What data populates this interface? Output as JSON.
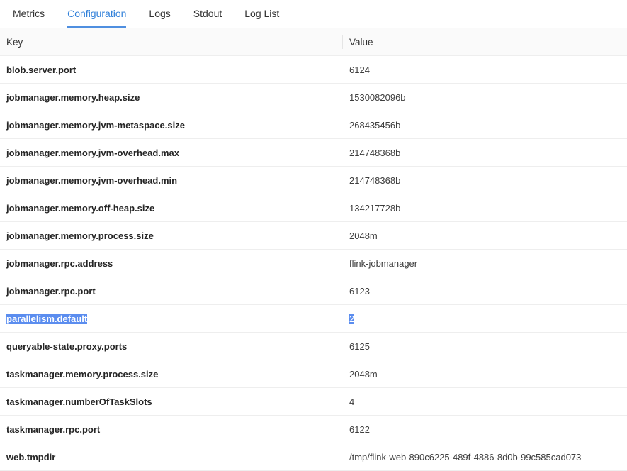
{
  "tabs": [
    {
      "label": "Metrics",
      "active": false
    },
    {
      "label": "Configuration",
      "active": true
    },
    {
      "label": "Logs",
      "active": false
    },
    {
      "label": "Stdout",
      "active": false
    },
    {
      "label": "Log List",
      "active": false
    }
  ],
  "table": {
    "headers": {
      "key": "Key",
      "value": "Value"
    },
    "rows": [
      {
        "key": "blob.server.port",
        "value": "6124"
      },
      {
        "key": "jobmanager.memory.heap.size",
        "value": "1530082096b"
      },
      {
        "key": "jobmanager.memory.jvm-metaspace.size",
        "value": "268435456b"
      },
      {
        "key": "jobmanager.memory.jvm-overhead.max",
        "value": "214748368b"
      },
      {
        "key": "jobmanager.memory.jvm-overhead.min",
        "value": "214748368b"
      },
      {
        "key": "jobmanager.memory.off-heap.size",
        "value": "134217728b"
      },
      {
        "key": "jobmanager.memory.process.size",
        "value": "2048m"
      },
      {
        "key": "jobmanager.rpc.address",
        "value": "flink-jobmanager"
      },
      {
        "key": "jobmanager.rpc.port",
        "value": "6123"
      },
      {
        "key": "parallelism.default",
        "value": "2",
        "selected": true
      },
      {
        "key": "queryable-state.proxy.ports",
        "value": "6125"
      },
      {
        "key": "taskmanager.memory.process.size",
        "value": "2048m"
      },
      {
        "key": "taskmanager.numberOfTaskSlots",
        "value": "4"
      },
      {
        "key": "taskmanager.rpc.port",
        "value": "6122"
      },
      {
        "key": "web.tmpdir",
        "value": "/tmp/flink-web-890c6225-489f-4886-8d0b-99c585cad073"
      }
    ]
  },
  "colors": {
    "accent": "#2f7fd9",
    "selection": "#5b8def"
  }
}
